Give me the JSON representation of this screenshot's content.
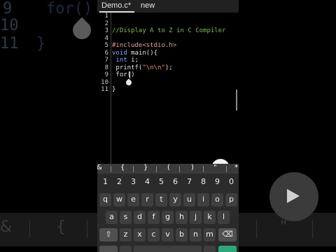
{
  "background": {
    "lines": [
      {
        "num": "9",
        "code": "for()"
      },
      {
        "num": "10",
        "code": ""
      },
      {
        "num": "11",
        "code": "}"
      }
    ],
    "keys": [
      "&",
      "{",
      "}",
      "\""
    ]
  },
  "tabs": [
    {
      "label": "Demo.c*",
      "active": true
    },
    {
      "label": "new",
      "active": false
    }
  ],
  "editor": {
    "lines": [
      {
        "num": "1",
        "code": ""
      },
      {
        "num": "2",
        "code": ""
      },
      {
        "num": "3",
        "code": "//Display A to Z in C Compiler"
      },
      {
        "num": "4",
        "code": ""
      },
      {
        "num": "5",
        "code": "#include<stdio.h>"
      },
      {
        "num": "6",
        "code_kw": "void",
        "code_rest": " main(){"
      },
      {
        "num": "7",
        "code_kw": " int",
        "code_rest": " i;"
      },
      {
        "num": "8",
        "code_fn": " printf(",
        "code_str": "\"\\n\\n\"",
        "code_end": ");"
      },
      {
        "num": "9",
        "code": " for()"
      },
      {
        "num": "10",
        "code": ""
      },
      {
        "num": "11",
        "code": "}"
      }
    ]
  },
  "symbols": [
    "&",
    "{",
    "}",
    "(",
    ")",
    "\"",
    "*"
  ],
  "keyboard": {
    "row_numbers": [
      "1",
      "2",
      "3",
      "4",
      "5",
      "6",
      "7",
      "8",
      "9",
      "0"
    ],
    "row1": [
      "q",
      "w",
      "e",
      "r",
      "t",
      "y",
      "u",
      "i",
      "o",
      "p"
    ],
    "row2": [
      "a",
      "s",
      "d",
      "f",
      "g",
      "h",
      "j",
      "k",
      "l"
    ],
    "row3": [
      "z",
      "x",
      "c",
      "v",
      "b",
      "n",
      "m"
    ],
    "shift": "⇧",
    "backspace": "⌫"
  },
  "colors": {
    "comment": "#7fbf4f",
    "keyword": "#7ab0ff",
    "preprocessor": "#e8a0a0",
    "string": "#e8a060",
    "enter_key": "#2ea67a"
  }
}
